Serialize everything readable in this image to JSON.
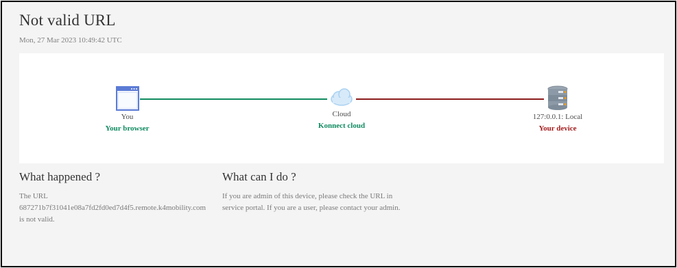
{
  "page": {
    "title": "Not valid URL",
    "timestamp": "Mon, 27 Mar 2023 10:49:42 UTC"
  },
  "diagram": {
    "browser": {
      "icon": "browser-window-icon",
      "name": "You",
      "label": "Your browser"
    },
    "cloud": {
      "icon": "cloud-icon",
      "name": "Cloud",
      "label": "Konnect cloud"
    },
    "device": {
      "icon": "database-server-icon",
      "name": "127:0.0.1: Local",
      "label": "Your device"
    },
    "colors": {
      "ok": "#0f8a5f",
      "error": "#a41c1c"
    }
  },
  "what_happened": {
    "heading": "What happened ?",
    "line1": "The URL",
    "line2": "687271b7f31041e08a7fd2fd0ed7d4f5.remote.k4mobility.com",
    "line3": "is not valid."
  },
  "what_can_i_do": {
    "heading": "What can I do ?",
    "line1": "If you are admin of this device, please check the URL in",
    "line2": "service portal. If you are a user, please contact your admin."
  }
}
